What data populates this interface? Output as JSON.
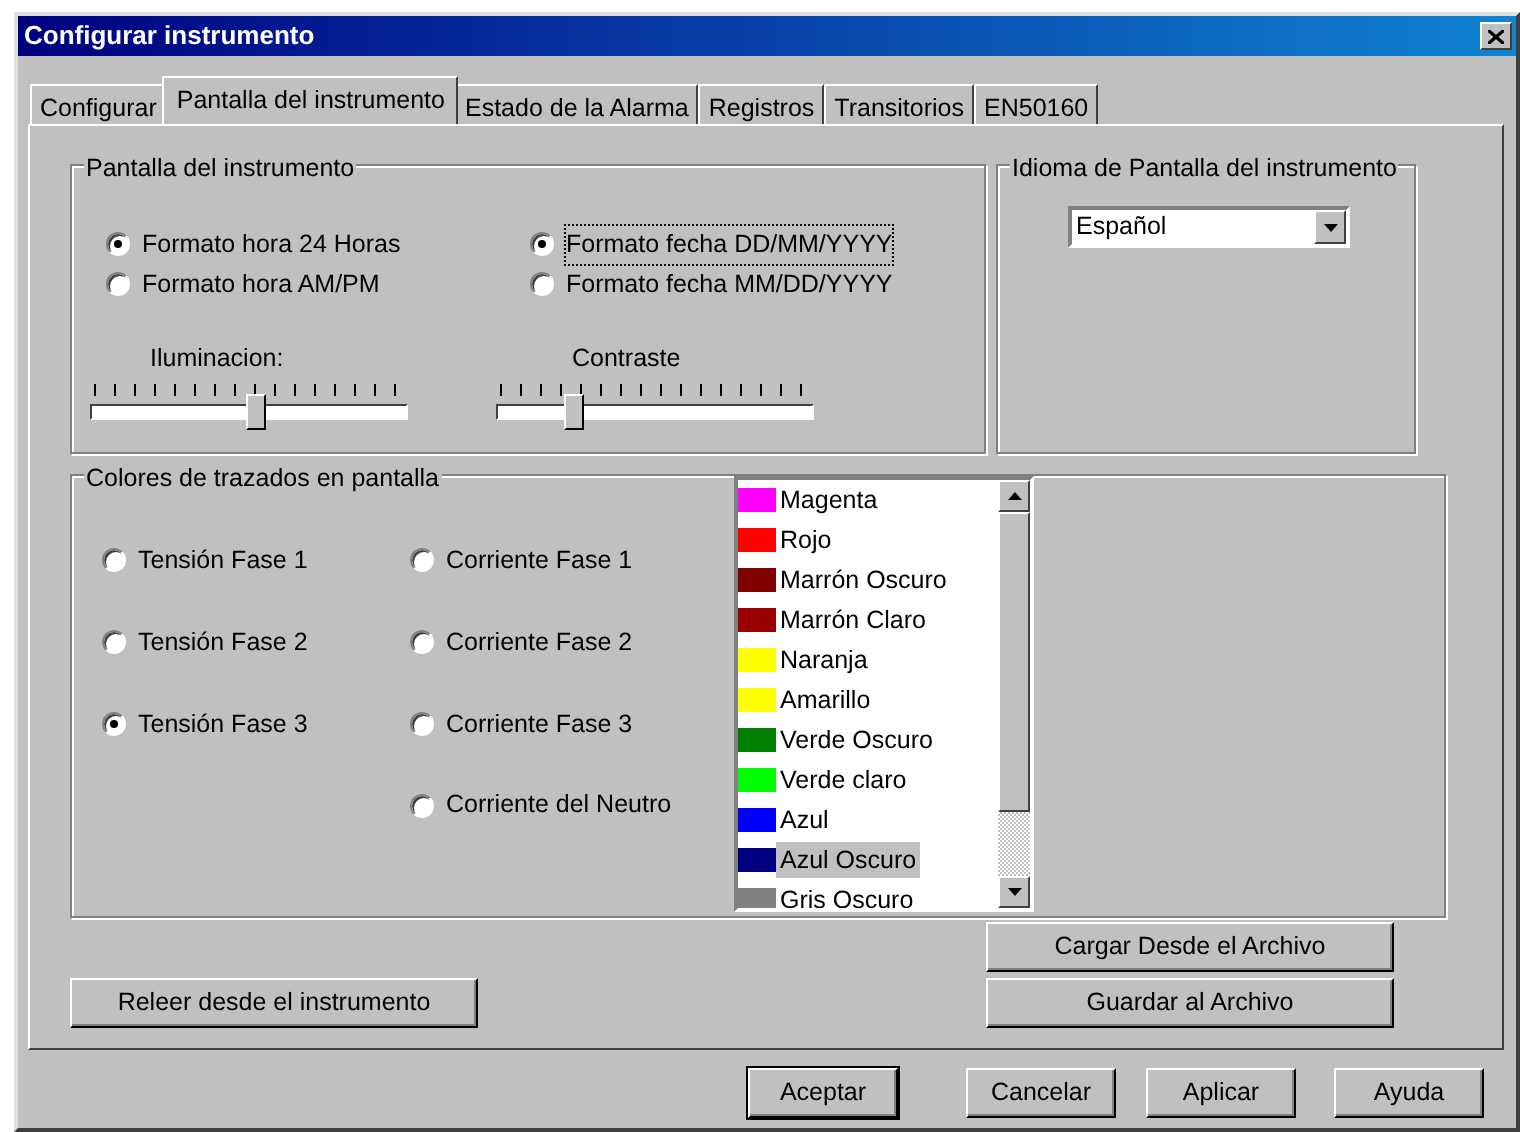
{
  "window": {
    "title": "Configurar instrumento"
  },
  "tabs": [
    {
      "label": "Configurar",
      "selected": false
    },
    {
      "label": "Pantalla del instrumento",
      "selected": true
    },
    {
      "label": "Estado de la Alarma",
      "selected": false
    },
    {
      "label": "Registros",
      "selected": false
    },
    {
      "label": "Transitorios",
      "selected": false
    },
    {
      "label": "EN50160",
      "selected": false
    }
  ],
  "display_group": {
    "title": "Pantalla del instrumento",
    "time_format": [
      {
        "label": "Formato hora 24 Horas",
        "selected": true
      },
      {
        "label": "Formato hora AM/PM",
        "selected": false
      }
    ],
    "date_format": [
      {
        "label": "Formato fecha DD/MM/YYYY",
        "selected": true,
        "focused": true
      },
      {
        "label": "Formato fecha MM/DD/YYYY",
        "selected": false,
        "focused": false
      }
    ],
    "sliders": [
      {
        "label": "Iluminacion:",
        "level": 0.52
      },
      {
        "label": "Contraste",
        "level": 0.22
      }
    ]
  },
  "language_group": {
    "title": "Idioma de Pantalla del instrumento",
    "value": "Español"
  },
  "colors_group": {
    "title": "Colores de trazados en pantalla",
    "voltage_traces": [
      {
        "label": "Tensión Fase 1",
        "selected": false
      },
      {
        "label": "Tensión Fase 2",
        "selected": false
      },
      {
        "label": "Tensión Fase 3",
        "selected": true
      }
    ],
    "current_traces": [
      {
        "label": "Corriente Fase 1",
        "selected": false
      },
      {
        "label": "Corriente Fase 2",
        "selected": false
      },
      {
        "label": "Corriente Fase 3",
        "selected": false
      },
      {
        "label": "Corriente del Neutro",
        "selected": false
      }
    ],
    "color_list": [
      {
        "label": "Magenta",
        "color": "#ff00ff",
        "selected": false
      },
      {
        "label": "Rojo",
        "color": "#ff0000",
        "selected": false
      },
      {
        "label": "Marrón Oscuro",
        "color": "#800000",
        "selected": false
      },
      {
        "label": "Marrón Claro",
        "color": "#990000",
        "selected": false
      },
      {
        "label": "Naranja",
        "color": "#ffff00",
        "selected": false
      },
      {
        "label": "Amarillo",
        "color": "#ffff01",
        "selected": false
      },
      {
        "label": "Verde Oscuro",
        "color": "#008000",
        "selected": false
      },
      {
        "label": "Verde claro",
        "color": "#00ff00",
        "selected": false
      },
      {
        "label": "Azul",
        "color": "#0000ff",
        "selected": false
      },
      {
        "label": "Azul Oscuro",
        "color": "#000080",
        "selected": true
      },
      {
        "label": "Gris Oscuro",
        "color": "#808080",
        "selected": false
      }
    ]
  },
  "file_buttons": [
    "Cargar Desde el Archivo",
    "Guardar al Archivo"
  ],
  "reload_button": "Releer desde el instrumento",
  "dialog_buttons": [
    {
      "label": "Aceptar",
      "default": true
    },
    {
      "label": "Cancelar",
      "default": false
    },
    {
      "label": "Aplicar",
      "default": false
    },
    {
      "label": "Ayuda",
      "default": false
    }
  ]
}
